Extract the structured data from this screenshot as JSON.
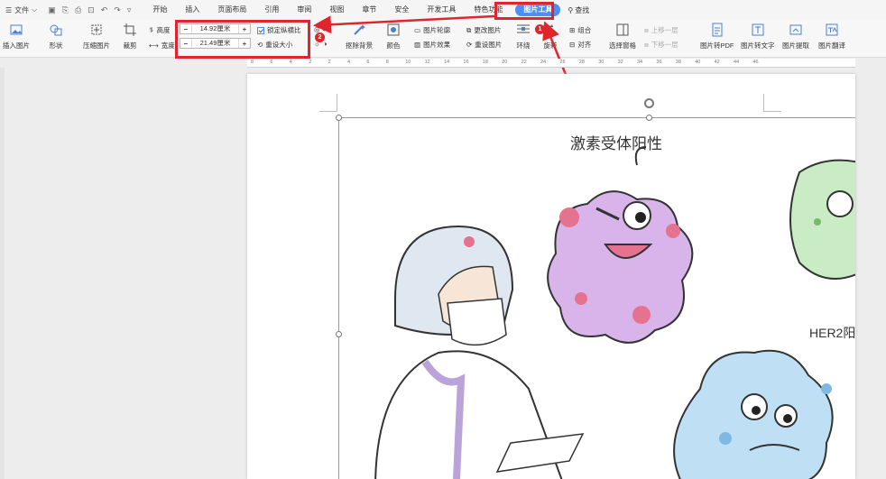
{
  "menubar": {
    "menu_icon": "hamburger-icon",
    "file_label": "文件",
    "tabs": [
      "开始",
      "插入",
      "页面布局",
      "引用",
      "审阅",
      "视图",
      "章节",
      "安全",
      "开发工具",
      "特色功能"
    ],
    "active_tab": "图片工具",
    "search_label": "查找"
  },
  "ribbon": {
    "insert_picture": "插入图片",
    "shape": "形状",
    "compress": "压缩图片",
    "crop": "裁剪",
    "height_label": "高度",
    "width_label": "宽度",
    "height_value": "14.92厘米",
    "width_value": "21.49厘米",
    "minus": "−",
    "plus": "+",
    "lock_ratio": "锁定纵横比",
    "reset_size": "重设大小",
    "remove_bg": "抠除背景",
    "color": "颜色",
    "picture_outline": "图片轮廓",
    "picture_effect": "图片效果",
    "change_picture": "更改图片",
    "reset_picture": "重设图片",
    "wrap": "环绕",
    "rotate": "旋转",
    "group": "组合",
    "align": "对齐",
    "bring_forward": "上移一层",
    "send_backward": "下移一层",
    "selection_pane": "选择窗格",
    "pic_to_pdf": "图片转PDF",
    "pic_to_text": "图片转文字",
    "pic_extract": "图片提取",
    "pic_translate": "图片翻译"
  },
  "annotations": {
    "badge1": "1",
    "badge2": "2",
    "accent": "#e0262c"
  },
  "ruler": {
    "ticks": [
      "8",
      "6",
      "4",
      "2",
      "2",
      "4",
      "6",
      "8",
      "10",
      "12",
      "14",
      "16",
      "18",
      "20",
      "22",
      "24",
      "26",
      "28",
      "30",
      "32",
      "34",
      "36",
      "38",
      "40",
      "42",
      "44",
      "46"
    ]
  },
  "document": {
    "caption_main": "激素受体阳性",
    "caption_side": "HER2阳"
  }
}
